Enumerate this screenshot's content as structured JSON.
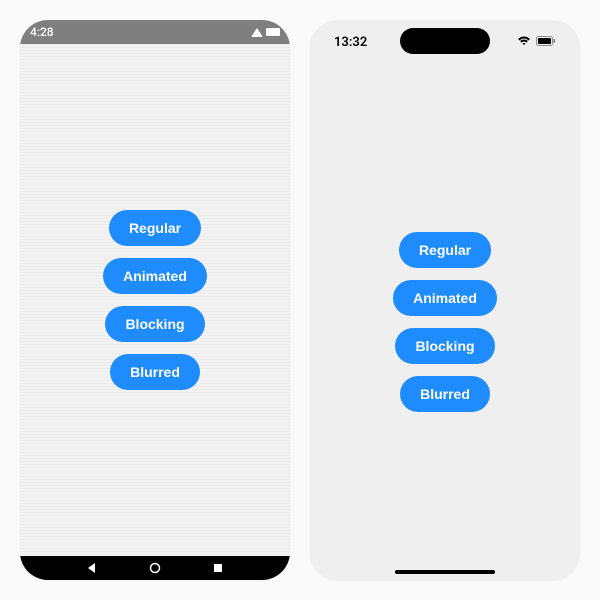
{
  "android": {
    "time": "4:28",
    "buttons": [
      "Regular",
      "Animated",
      "Blocking",
      "Blurred"
    ]
  },
  "ios": {
    "time": "13:32",
    "buttons": [
      "Regular",
      "Animated",
      "Blocking",
      "Blurred"
    ]
  },
  "colors": {
    "button_bg": "#1e8cff",
    "button_fg": "#ffffff",
    "android_status_bg": "#7f7f7f",
    "android_nav_bg": "#000000"
  }
}
